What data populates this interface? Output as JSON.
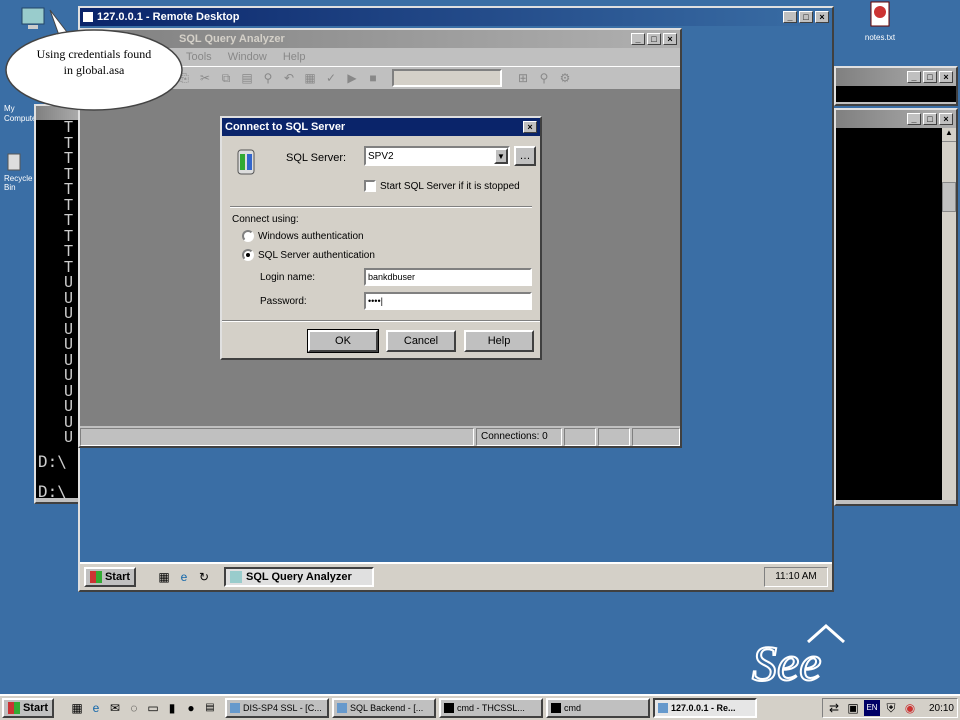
{
  "callout": {
    "text": "Using credentials found in global.asa"
  },
  "desktop": {
    "icon_notes_label": "notes.txt",
    "icon_mycomputer_label": "My Computer",
    "icon_recycle_label": "Recycle Bin"
  },
  "remote_desktop": {
    "title": "127.0.0.1 - Remote Desktop"
  },
  "query_analyzer": {
    "title": "SQL Query Analyzer",
    "menu": [
      "Tools",
      "Window",
      "Help"
    ],
    "status_connections": "Connections: 0"
  },
  "dialog": {
    "title": "Connect to SQL Server",
    "sql_server_label": "SQL Server:",
    "sql_server_value": "SPV2",
    "start_if_stopped_label": "Start SQL Server if it is stopped",
    "connect_using_label": "Connect using:",
    "windows_auth_label": "Windows authentication",
    "sql_auth_label": "SQL Server authentication",
    "login_label": "Login name:",
    "login_value": "bankdbuser",
    "password_label": "Password:",
    "password_value": "••••|",
    "ok_label": "OK",
    "cancel_label": "Cancel",
    "help_label": "Help"
  },
  "cmd_left": {
    "lines": [
      "T",
      "T",
      "T",
      "T",
      "T",
      "T",
      "T",
      "T",
      "T",
      "T",
      "U",
      "U",
      "U",
      "U",
      "U",
      "U",
      "U",
      "U",
      "U",
      "U",
      "U"
    ],
    "prompt1": "D:\\",
    "prompt2": "D:\\"
  },
  "inner_taskbar": {
    "start_label": "Start",
    "task_label": "SQL Query Analyzer",
    "clock": "11:10 AM"
  },
  "outer_taskbar": {
    "start_label": "Start",
    "tasks": [
      "DIS-SP4 SSL - [C...",
      "SQL Backend - [...",
      "cmd - THCSSL...",
      "cmd",
      "127.0.0.1 - Re..."
    ],
    "clock": "20:10"
  },
  "logo": {
    "text": "See"
  },
  "colors": {
    "desktop": "#3a6ea5",
    "title_active": "#0a246a",
    "dialog_bg": "#d4d0c8"
  }
}
